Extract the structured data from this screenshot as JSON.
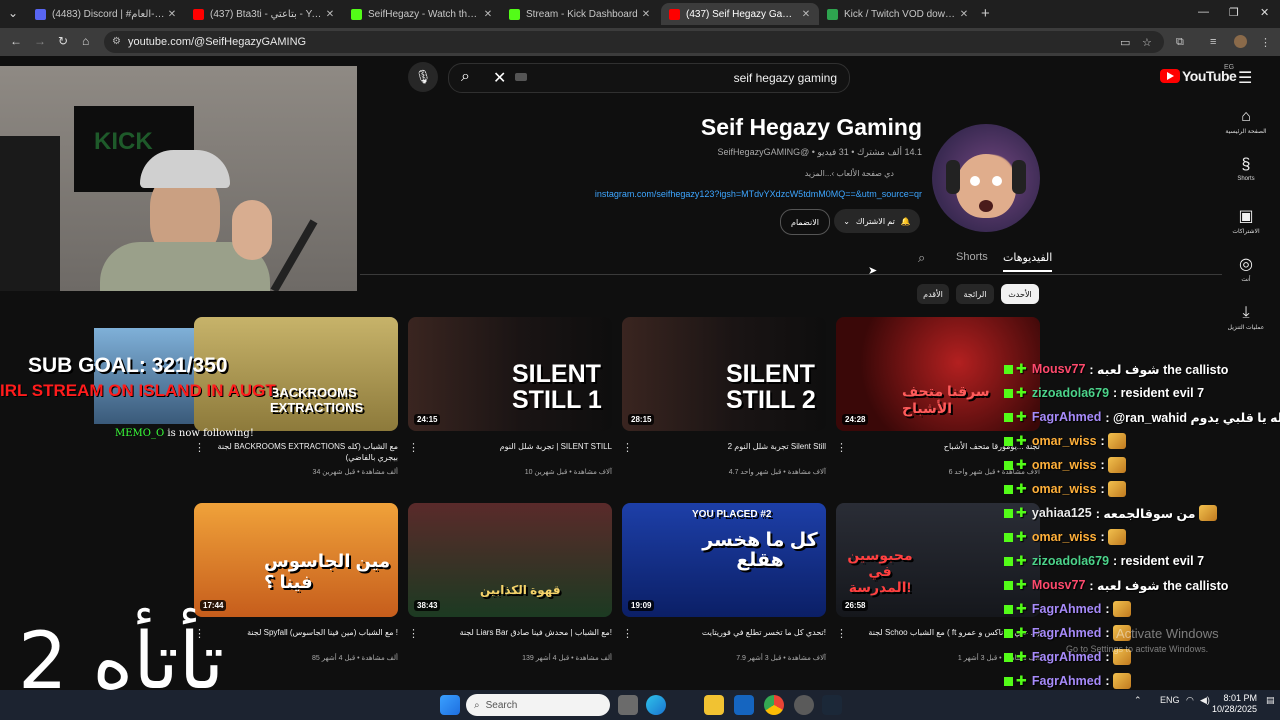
{
  "tabs": [
    {
      "title": "(4483) Discord | #الشات-العام",
      "color": "#c63a8c"
    },
    {
      "title": "(437) Bta3ti - بتاعتي - YouTube",
      "color": "#ff0000"
    },
    {
      "title": "SeifHegazy - Watch the VOD on",
      "color": "#53fc18"
    },
    {
      "title": "Stream - Kick Dashboard",
      "color": "#53fc18"
    },
    {
      "title": "(437) Seif Hegazy Gaming - You",
      "color": "#ff0000"
    },
    {
      "title": "Kick / Twitch VOD downloader",
      "color": "#2ea44f"
    }
  ],
  "url": "youtube.com/@SeifHegazyGAMING",
  "search": {
    "query": "seif hegazy gaming"
  },
  "yt": {
    "logo": "YouTube",
    "country": "EG"
  },
  "rail": [
    {
      "icon": "home-icon",
      "label": "الصفحة الرئيسية",
      "glyph": "⌂"
    },
    {
      "icon": "shorts-icon",
      "label": "Shorts",
      "glyph": "§"
    },
    {
      "icon": "subscriptions-icon",
      "label": "الاشتراكات",
      "glyph": "▣"
    },
    {
      "icon": "you-icon",
      "label": "أنت",
      "glyph": "◎"
    },
    {
      "icon": "downloads-icon",
      "label": "عمليات التنزيل",
      "glyph": "⤓"
    }
  ],
  "channel": {
    "name": "Seif Hegazy Gaming",
    "meta": "SeifHegazyGAMING@ • ‏14.1 ألف مشترك • 31 فيديو",
    "desc": "دي صفحة الألعاب ›...المزيد",
    "link": "instagram.com/seifhegazy123?igsh=MTdvYXdzcW5tdmM0MQ==&utm_source=qr",
    "subscribed": "تم الاشتراك",
    "join": "الانضمام"
  },
  "channel_tabs": [
    "الفيديوهات",
    "Shorts"
  ],
  "chips": [
    "الأحدث",
    "الرائجة",
    "الأقدم"
  ],
  "videos": [
    {
      "title": "لجنة BACKROOMS EXTRACTIONS مع الشباب (كله بيجري بالفاضي)",
      "meta": "34 ألف مشاهدة • قبل شهرين",
      "duration": "",
      "thumb_text": "BACKROOMS EXTRACTIONS"
    },
    {
      "title": "تجربة شلل النوم | SILENT STILL",
      "meta": "10 آلاف مشاهدة • قبل شهرين",
      "duration": "24:15",
      "thumb_text": "SILENT STILL 1"
    },
    {
      "title": "تجربة شلل النوم 2 Silent Still",
      "meta": "4.7 آلاف مشاهدة • قبل شهر واحد",
      "duration": "28:15",
      "thumb_text": "SILENT STILL 2"
    },
    {
      "title": "لجنة ...يومورقا متحف الأشباح",
      "meta": "6 آلاف مشاهدة • قبل شهر واحد",
      "duration": "24:28",
      "thumb_text": "سرقنا متحف الأشباح"
    },
    {
      "title": "لجنة Spyfall مع الشباب (مين فينا الجاسوس) !",
      "meta": "85 ألف مشاهدة • قبل 4 أشهر",
      "duration": "17:44",
      "thumb_text": "مين الجاسوس فينا ؟"
    },
    {
      "title": "لجنة Liars Bar مع الشباب | محدش فينا صادق!",
      "meta": "139 ألف مشاهدة • قبل 4 أشهر",
      "duration": "38:43",
      "thumb_text": "قهوة الكذابين"
    },
    {
      "title": "تحدي كل ما تخسر تطلع في فوريتايت!",
      "meta": "7.9 آلاف مشاهدة • قبل 3 أشهر",
      "duration": "19:09",
      "thumb_text": "كل ما هخسر هقلع"
    },
    {
      "title": "لجنة Schoo مع الشباب ( ft علي براناكس و عمرو ...)",
      "meta": "1 ألف مشاهدة • قبل 3 أشهر",
      "duration": "26:58",
      "thumb_text": "محبوسين في المدرسة!"
    }
  ],
  "overlay": {
    "sub_goal": "SUB GOAL: 321/350",
    "irl": "IRL STREAM ON ISLAND IN AUGT",
    "follower": "MEMO_O",
    "follow_text": "is now following!",
    "big": "2 تأتأه"
  },
  "chat": [
    {
      "user": "Mousv77",
      "text": ": شوف لعبه the callisto",
      "color": "#ff4a6d"
    },
    {
      "user": "zizoadola679",
      "text": ": resident evil 7",
      "color": "#4cd38a"
    },
    {
      "user": "FagrAhmed",
      "text": ": @ran_wahid الحمدلله يا قلبي يدوم",
      "color": "#a78bfa"
    },
    {
      "user": "omar_wiss",
      "text": ":",
      "color": "#ffb03a",
      "emote": true
    },
    {
      "user": "omar_wiss",
      "text": ":",
      "color": "#ffb03a",
      "emote": true
    },
    {
      "user": "omar_wiss",
      "text": ":",
      "color": "#ffb03a",
      "emote": true
    },
    {
      "user": "yahiaa125",
      "text": ": من سوقالجمعه",
      "color": "#e9e9e9",
      "emote": true
    },
    {
      "user": "omar_wiss",
      "text": ":",
      "color": "#ffb03a",
      "emote": true
    },
    {
      "user": "zizoadola679",
      "text": ": resident evil 7",
      "color": "#4cd38a"
    },
    {
      "user": "Mousv77",
      "text": ": شوف لعبه the callisto",
      "color": "#ff4a6d"
    },
    {
      "user": "FagrAhmed",
      "text": ":",
      "color": "#a78bfa",
      "emote": true
    },
    {
      "user": "FagrAhmed",
      "text": ":",
      "color": "#a78bfa",
      "emote": true
    },
    {
      "user": "FagrAhmed",
      "text": ":",
      "color": "#a78bfa",
      "emote": true
    },
    {
      "user": "FagrAhmed",
      "text": ":",
      "color": "#a78bfa",
      "emote": true
    }
  ],
  "watermark": {
    "line1": "Activate Windows",
    "line2": "Go to Settings to activate Windows."
  },
  "taskbar": {
    "search": "Search",
    "lang": "ENG",
    "time": "8:01 PM",
    "date": "10/28/2025"
  }
}
